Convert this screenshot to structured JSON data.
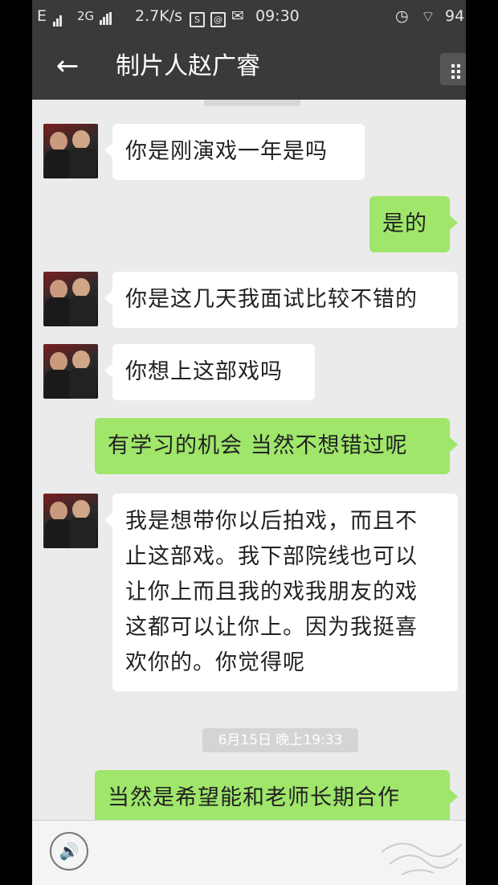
{
  "status_bar": {
    "net1": "E",
    "net2": "2G",
    "speed": "2.7K/s",
    "box1": "S",
    "box2": "@",
    "mail": "✉",
    "time": "09:30",
    "alarm": "◷",
    "wifi": "⌔",
    "battery": "94"
  },
  "header": {
    "back_icon": "←",
    "title": "制片人赵广睿"
  },
  "messages": [
    {
      "side": "left",
      "text": "你是刚演戏一年是吗"
    },
    {
      "side": "right",
      "text": "是的"
    },
    {
      "side": "left",
      "text": "你是这几天我面试比较不错的"
    },
    {
      "side": "left",
      "text": "你想上这部戏吗"
    },
    {
      "side": "right",
      "text": "有学习的机会 当然不想错过呢"
    },
    {
      "side": "left",
      "lines": [
        "我是想带你以后拍戏，而且不",
        "止这部戏。我下部院线也可以",
        "让你上而且我的戏我朋友的戏",
        "这都可以让你上。因为我挺喜",
        "欢你的。你觉得呢"
      ]
    },
    {
      "side": "right",
      "text": "当然是希望能和老师长期合作"
    }
  ],
  "timestamp": "6月15日 晚上19:33",
  "input_bar": {
    "voice_icon": "🔊"
  },
  "colors": {
    "header_bg": "#3a3a3a",
    "chat_bg": "#ebebeb",
    "bubble_in": "#ffffff",
    "bubble_out": "#9fe66b"
  }
}
